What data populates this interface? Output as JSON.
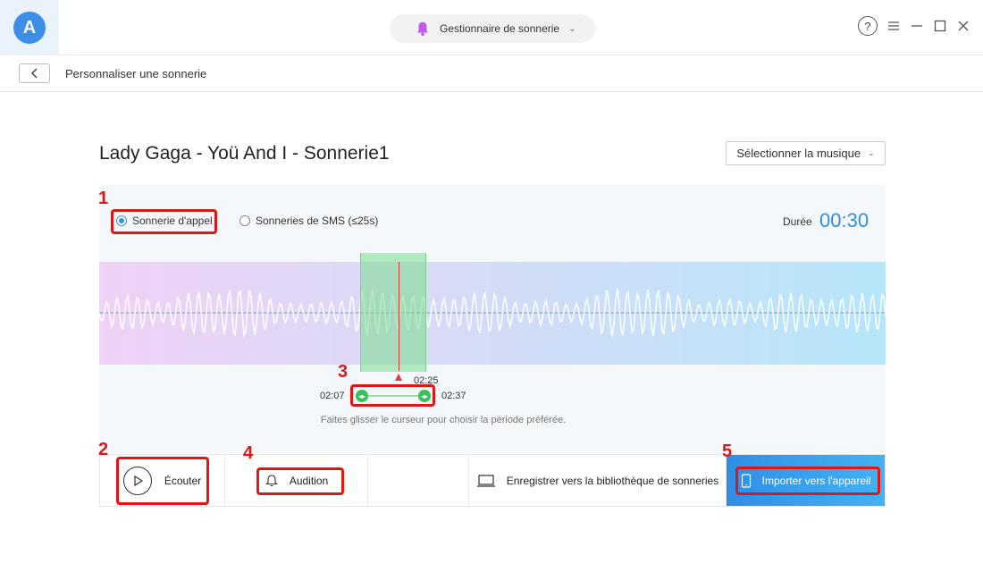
{
  "header": {
    "module_label": "Gestionnaire de sonnerie",
    "help_glyph": "?"
  },
  "breadcrumb": {
    "title": "Personnaliser une sonnerie"
  },
  "main": {
    "song_title": "Lady Gaga - Yoü And I - Sonnerie1",
    "select_music_label": "Sélectionner la musique"
  },
  "editor": {
    "radio_call": "Sonnerie d'appel",
    "radio_sms": "Sonneries de SMS (≤25s)",
    "duration_label": "Durée",
    "duration_value": "00:30",
    "time_current": "02:25",
    "time_start": "02:07",
    "time_end": "02:37",
    "hint": "Faites glisser le curseur pour choisir la période préférée."
  },
  "actions": {
    "listen": "Écouter",
    "audition": "Audition",
    "save_library": "Enregistrer vers la bibliothèque de sonneries",
    "import_device": "Importer vers l'appareil"
  },
  "annotations": [
    "1",
    "2",
    "3",
    "4",
    "5"
  ],
  "colors": {
    "accent": "#3d8ee6",
    "selection": "#37c159",
    "annotation": "#e01616",
    "playhead": "#e23838"
  },
  "icons": [
    "app-logo-icon",
    "bell-icon",
    "chevron-down-icon",
    "help-icon",
    "menu-icon",
    "minimize-icon",
    "maximize-icon",
    "close-icon",
    "back-icon",
    "play-icon",
    "bell-outline-icon",
    "laptop-icon",
    "phone-icon"
  ]
}
